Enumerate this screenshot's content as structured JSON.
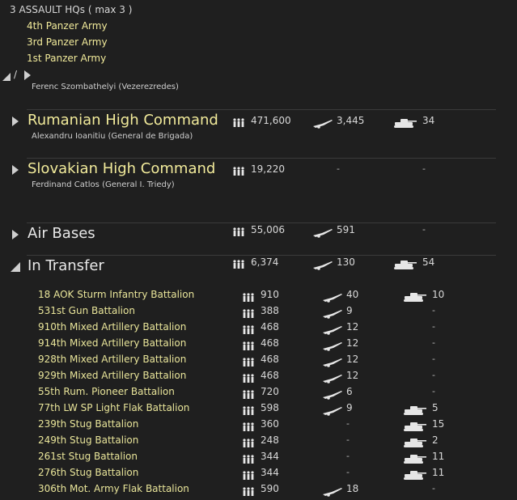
{
  "assault": {
    "header": "3 ASSAULT HQs ( max 3 )",
    "armies": [
      "4th Panzer Army",
      "3rd Panzer Army",
      "1st Panzer Army"
    ],
    "slash": "/",
    "commander": "Ferenc Szombathelyi  (Vezerezredes)"
  },
  "groups": [
    {
      "title": "Rumanian High Command",
      "commander": "Alexandru Ioanitiu  (General de Brigada)",
      "men": "471,600",
      "guns": "3,445",
      "tanks": "34"
    },
    {
      "title": "Slovakian High Command",
      "commander": "Ferdinand Catlos  (General I. Triedy)",
      "men": "19,220",
      "guns": "-",
      "tanks": "-"
    },
    {
      "title": "Air Bases",
      "men": "55,006",
      "guns": "591",
      "tanks": "-"
    },
    {
      "title": "In Transfer",
      "men": "6,374",
      "guns": "130",
      "tanks": "54"
    }
  ],
  "units": [
    {
      "name": "18 AOK Sturm Infantry Battalion",
      "men": "910",
      "guns": "40",
      "tanks": "10"
    },
    {
      "name": "531st Gun Battalion",
      "men": "388",
      "guns": "9",
      "tanks": "-"
    },
    {
      "name": "910th Mixed Artillery Battalion",
      "men": "468",
      "guns": "12",
      "tanks": "-"
    },
    {
      "name": "914th Mixed Artillery Battalion",
      "men": "468",
      "guns": "12",
      "tanks": "-"
    },
    {
      "name": "928th Mixed Artillery Battalion",
      "men": "468",
      "guns": "12",
      "tanks": "-"
    },
    {
      "name": "929th Mixed Artillery Battalion",
      "men": "468",
      "guns": "12",
      "tanks": "-"
    },
    {
      "name": "55th Rum. Pioneer Battalion",
      "men": "720",
      "guns": "6",
      "tanks": "-"
    },
    {
      "name": "77th LW SP Light Flak Battalion",
      "men": "598",
      "guns": "9",
      "tanks": "5"
    },
    {
      "name": "239th Stug Battalion",
      "men": "360",
      "guns": "-",
      "tanks": "15"
    },
    {
      "name": "249th Stug Battalion",
      "men": "248",
      "guns": "-",
      "tanks": "2"
    },
    {
      "name": "261st Stug Battalion",
      "men": "344",
      "guns": "-",
      "tanks": "11"
    },
    {
      "name": "276th Stug Battalion",
      "men": "344",
      "guns": "-",
      "tanks": "11"
    },
    {
      "name": "306th Mot. Army Flak Battalion",
      "men": "590",
      "guns": "18",
      "tanks": "-"
    }
  ],
  "icons": {
    "men": "infantry-icon",
    "guns": "artillery-icon",
    "tanks": "tank-icon",
    "expand": "expand-arrow-icon",
    "collapse": "collapse-arrow-icon"
  }
}
